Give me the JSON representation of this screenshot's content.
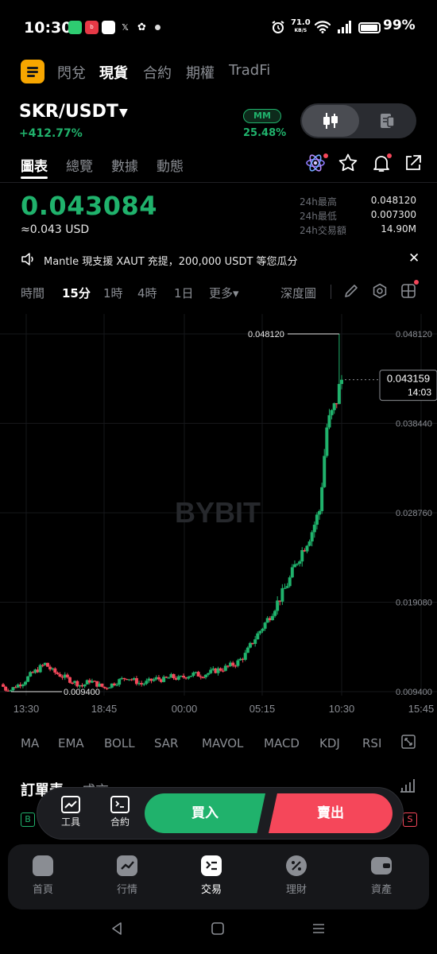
{
  "status_bar": {
    "time": "10:30",
    "net_speed": "71.0",
    "net_unit": "KB/S",
    "battery": "99%"
  },
  "top_tabs": [
    "閃兌",
    "現貨",
    "合約",
    "期權",
    "TradFi"
  ],
  "pair": {
    "symbol": "SKR/USDT",
    "change": "+412.77%",
    "mm_label": "MM",
    "mm_value": "25.48%"
  },
  "sub_tabs": [
    "圖表",
    "總覽",
    "數據",
    "動態"
  ],
  "ticker": {
    "price": "0.043084",
    "price_usd": "≈0.043 USD",
    "high_label": "24h最高",
    "high": "0.048120",
    "low_label": "24h最低",
    "low": "0.007300",
    "volume_label": "24h交易額",
    "volume": "14.90M"
  },
  "announcement": {
    "text": "Mantle 現支援 XAUT 充提，200,000 USDT 等您瓜分"
  },
  "chart_toolbar": {
    "timeframes": [
      "時間",
      "15分",
      "1時",
      "4時",
      "1日",
      "更多▾"
    ],
    "depth": "深度圖"
  },
  "chart_data": {
    "type": "candlestick",
    "watermark": "BYBIT",
    "y_ticks": [
      "0.048120",
      "0.038440",
      "0.028760",
      "0.019080",
      "0.009400"
    ],
    "x_ticks": [
      "13:30",
      "18:45",
      "00:00",
      "05:15",
      "10:30",
      "15:45"
    ],
    "high_marker": "0.048120",
    "low_marker": "0.009400",
    "last_price": "0.043159",
    "last_price_time": "14:03",
    "ylim": [
      0.0094,
      0.04812
    ],
    "approx_close_path": [
      0.0102,
      0.0094,
      0.01,
      0.0104,
      0.0112,
      0.0118,
      0.0124,
      0.0116,
      0.0112,
      0.0108,
      0.0104,
      0.01,
      0.0106,
      0.0102,
      0.0098,
      0.0102,
      0.0106,
      0.011,
      0.0106,
      0.0102,
      0.0105,
      0.0108,
      0.0107,
      0.011,
      0.0108,
      0.0111,
      0.0113,
      0.0112,
      0.0114,
      0.0117,
      0.0119,
      0.0122,
      0.0126,
      0.0134,
      0.0148,
      0.016,
      0.0172,
      0.0186,
      0.02,
      0.0216,
      0.0236,
      0.0252,
      0.0268,
      0.029,
      0.038,
      0.04,
      0.0432
    ]
  },
  "indicators": [
    "MA",
    "EMA",
    "BOLL",
    "SAR",
    "MAVOL",
    "MACD",
    "KDJ",
    "RSI"
  ],
  "order_book": {
    "title": "訂單表",
    "subtitle": "成交",
    "buy_tag": "B",
    "sell_tag": "S"
  },
  "trade_bar": {
    "tools_label": "工具",
    "contract_label": "合約",
    "buy": "買入",
    "sell": "賣出"
  },
  "bottom_nav": [
    "首頁",
    "行情",
    "交易",
    "理財",
    "資產"
  ],
  "colors": {
    "up": "#20b26c",
    "down": "#f5475a",
    "accent": "#f7a600"
  }
}
